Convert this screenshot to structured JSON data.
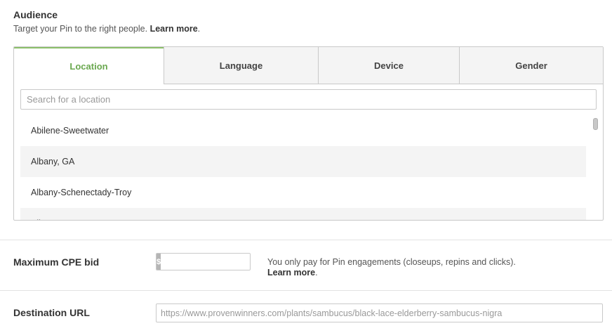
{
  "audience": {
    "title": "Audience",
    "subtitle": "Target your Pin to the right people.",
    "learn_more": "Learn more",
    "period": "."
  },
  "tabs": [
    {
      "label": "Location",
      "active": true
    },
    {
      "label": "Language",
      "active": false
    },
    {
      "label": "Device",
      "active": false
    },
    {
      "label": "Gender",
      "active": false
    }
  ],
  "location_search": {
    "placeholder": "Search for a location",
    "value": ""
  },
  "locations": [
    "Abilene-Sweetwater",
    "Albany, GA",
    "Albany-Schenectady-Troy",
    "Albuquerque-Santa Fe"
  ],
  "bid": {
    "label": "Maximum CPE bid",
    "currency": "$",
    "value": "",
    "help": "You only pay for Pin engagements (closeups, repins and clicks).",
    "learn_more": "Learn more",
    "period": "."
  },
  "destination": {
    "label": "Destination URL",
    "placeholder": "https://www.provenwinners.com/plants/sambucus/black-lace-elderberry-sambucus-nigra",
    "value": ""
  },
  "colors": {
    "accent": "#6aa84f",
    "tab_bg": "#f4f4f4",
    "border": "#c9c9c9"
  }
}
